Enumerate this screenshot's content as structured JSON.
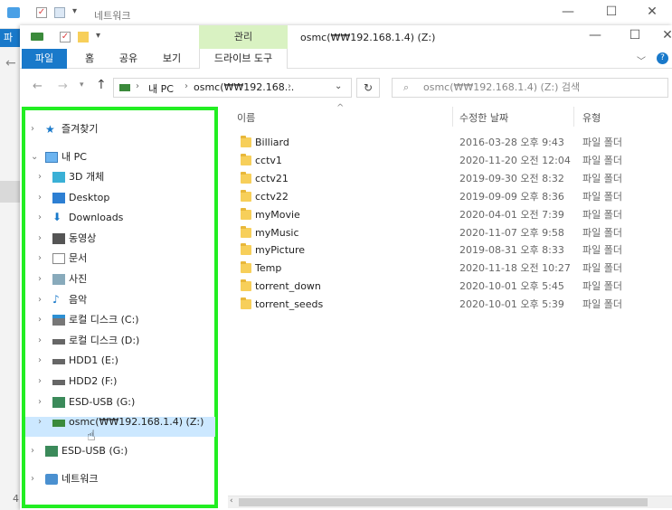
{
  "background_window": {
    "title": "네트워크",
    "side_label_1": "파",
    "side_label_2": "4"
  },
  "window": {
    "title": "osmc(₩₩192.168.1.4) (Z:)",
    "manage_tab": "관리"
  },
  "ribbon": {
    "tabs": [
      "파일",
      "홈",
      "공유",
      "보기",
      "드라이브 도구"
    ]
  },
  "address": {
    "crumbs": [
      "내 PC",
      "osmc(₩₩192.168..."
    ],
    "search_placeholder": "osmc(₩₩192.168.1.4) (Z:) 검색"
  },
  "nav": {
    "quick_access": "즐겨찾기",
    "this_pc": "내 PC",
    "items": [
      {
        "label": "3D 개체",
        "icon": "3d-objects-icon"
      },
      {
        "label": "Desktop",
        "icon": "desktop-icon"
      },
      {
        "label": "Downloads",
        "icon": "downloads-icon"
      },
      {
        "label": "동영상",
        "icon": "videos-icon"
      },
      {
        "label": "문서",
        "icon": "documents-icon"
      },
      {
        "label": "사진",
        "icon": "pictures-icon"
      },
      {
        "label": "음악",
        "icon": "music-icon"
      },
      {
        "label": "로컬 디스크 (C:)",
        "icon": "windows-drive-icon"
      },
      {
        "label": "로컬 디스크 (D:)",
        "icon": "drive-icon"
      },
      {
        "label": "HDD1 (E:)",
        "icon": "drive-icon"
      },
      {
        "label": "HDD2 (F:)",
        "icon": "drive-icon"
      },
      {
        "label": "ESD-USB (G:)",
        "icon": "usb-drive-icon"
      },
      {
        "label": "osmc(₩₩192.168.1.4) (Z:)",
        "icon": "network-drive-icon"
      }
    ],
    "esd_usb": "ESD-USB (G:)",
    "network": "네트워크"
  },
  "columns": {
    "name": "이름",
    "date": "수정한 날짜",
    "type": "유형"
  },
  "files": [
    {
      "name": "Billiard",
      "date": "2016-03-28 오후 9:43",
      "type": "파일 폴더"
    },
    {
      "name": "cctv1",
      "date": "2020-11-20 오전 12:04",
      "type": "파일 폴더"
    },
    {
      "name": "cctv21",
      "date": "2019-09-30 오전 8:32",
      "type": "파일 폴더"
    },
    {
      "name": "cctv22",
      "date": "2019-09-09 오후 8:36",
      "type": "파일 폴더"
    },
    {
      "name": "myMovie",
      "date": "2020-04-01 오전 7:39",
      "type": "파일 폴더"
    },
    {
      "name": "myMusic",
      "date": "2020-11-07 오후 9:58",
      "type": "파일 폴더"
    },
    {
      "name": "myPicture",
      "date": "2019-08-31 오후 8:33",
      "type": "파일 폴더"
    },
    {
      "name": "Temp",
      "date": "2020-11-18 오전 10:27",
      "type": "파일 폴더"
    },
    {
      "name": "torrent_down",
      "date": "2020-10-01 오후 5:45",
      "type": "파일 폴더"
    },
    {
      "name": "torrent_seeds",
      "date": "2020-10-01 오후 5:39",
      "type": "파일 폴더"
    }
  ],
  "colors": {
    "highlight_border": "#22ee22",
    "selection": "#cce8ff",
    "file_tab": "#1979ca",
    "manage_tab": "#d9f2c2"
  }
}
